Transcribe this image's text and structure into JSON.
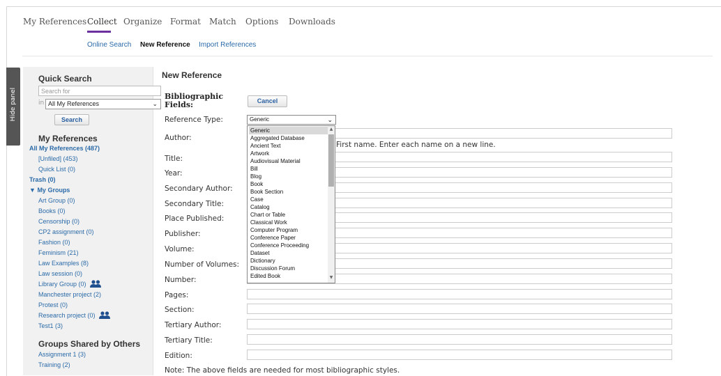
{
  "nav": {
    "tabs": [
      "My References",
      "Collect",
      "Organize",
      "Format",
      "Match",
      "Options",
      "Downloads"
    ],
    "active_tab": "Collect",
    "subtabs": [
      "Online Search",
      "New Reference",
      "Import References"
    ],
    "active_subtab": "New Reference"
  },
  "hide_panel": "Hide panel",
  "quick_search": {
    "title": "Quick Search",
    "placeholder": "Search for",
    "in_label": "in",
    "scope": "All My References",
    "button": "Search"
  },
  "my_references": {
    "title": "My References",
    "all": "All My References (487)",
    "unfiled": "[Unfiled] (453)",
    "quick_list": "Quick List (0)",
    "trash": "Trash (0)",
    "my_groups": "My Groups",
    "groups": [
      "Art Group (0)",
      "Books (0)",
      "Censorship (0)",
      "CP2 assignment (0)",
      "Fashion (0)",
      "Feminism (21)",
      "Law Examples (8)",
      "Law session (0)",
      "Library Group (0)",
      "Manchester project (2)",
      "Protest (0)",
      "Research project (0)",
      "Test1 (3)"
    ]
  },
  "shared": {
    "title": "Groups Shared by Others",
    "groups": [
      "Assignment 1 (3)",
      "Training (2)"
    ]
  },
  "main": {
    "title": "New Reference",
    "bib_label_1": "Bibliographic",
    "bib_label_2": "Fields:",
    "cancel": "Cancel",
    "reference_type_label": "Reference Type:",
    "reference_type_value": "Generic",
    "author_help": "First name. Enter each name on a new line.",
    "fields": [
      "Author:",
      "Title:",
      "Year:",
      "Secondary Author:",
      "Secondary Title:",
      "Place Published:",
      "Publisher:",
      "Volume:",
      "Number of Volumes:",
      "Number:",
      "Pages:",
      "Section:",
      "Tertiary Author:",
      "Tertiary Title:",
      "Edition:"
    ],
    "note": "Note: The above fields are needed for most bibliographic styles."
  },
  "dropdown_options": [
    "Generic",
    "Aggregated Database",
    "Ancient Text",
    "Artwork",
    "Audiovisual Material",
    "Bill",
    "Blog",
    "Book",
    "Book Section",
    "Case",
    "Catalog",
    "Chart or Table",
    "Classical Work",
    "Computer Program",
    "Conference Paper",
    "Conference Proceeding",
    "Dataset",
    "Dictionary",
    "Discussion Forum",
    "Edited Book"
  ],
  "colors": {
    "accent": "#6b2f9e",
    "link": "#2a6aa8",
    "panel": "#f1f1f1"
  }
}
